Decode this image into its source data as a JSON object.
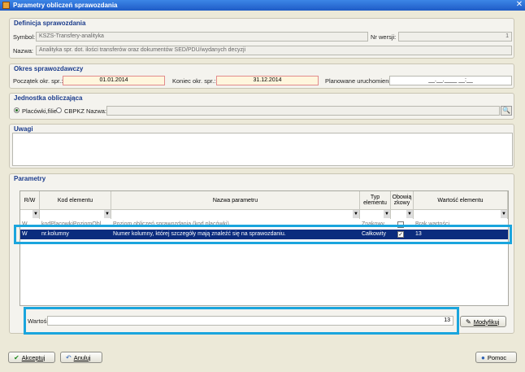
{
  "window": {
    "title": "Parametry obliczeń sprawozdania"
  },
  "definicja": {
    "title": "Definicja sprawozdania",
    "symbol_label": "Symbol:",
    "symbol_value": "KSZS-Transfery-analityka",
    "nr_wersji_label": "Nr wersji:",
    "nr_wersji_value": "1",
    "nazwa_label": "Nazwa:",
    "nazwa_value": "Analityka spr. dot. ilości transferów oraz dokumentów SED/PDU/wydanych decyzji"
  },
  "okres": {
    "title": "Okres sprawozdawczy",
    "poczatek_label": "Początek okr. spr.:",
    "poczatek_value": "01.01.2014",
    "koniec_label": "Koniec okr. spr.:",
    "koniec_value": "31.12.2014",
    "planowane_label": "Planowane uruchomienie:",
    "planowane_value": "__.__.____ __:__"
  },
  "jednostka": {
    "title": "Jednostka obliczająca",
    "radio1_label": "Placówki,filie",
    "radio2_label": "CBPKZ",
    "nazwa_label": "Nazwa:",
    "nazwa_value": ""
  },
  "uwagi": {
    "title": "Uwagi",
    "value": ""
  },
  "parametry": {
    "title": "Parametry",
    "columns": [
      "R/W",
      "Kod elementu",
      "Nazwa parametru",
      "Typ elementu",
      "Obowią zkowy",
      "Wartość elementu"
    ],
    "rows": [
      {
        "rw": "W",
        "kod": "kodPlacowkiPoziomObl",
        "nazwa": "Poziom obliczeń sprawozdania (kod placówki)",
        "typ": "Znakowy",
        "obow": false,
        "wartosc": "Brak wartości"
      },
      {
        "rw": "W",
        "kod": "nr.kolumny",
        "nazwa": "Numer kolumny, której szczegóły mają znaleźć się na sprawozdaniu.",
        "typ": "Całkowity",
        "obow": true,
        "wartosc": "13"
      }
    ],
    "wartosc_label": "Wartość:",
    "wartosc_value": "13",
    "modyfikuj_label": "Modyfikuj"
  },
  "footer": {
    "akceptuj_label": "Akceptuj",
    "anuluj_label": "Anuluj",
    "pomoc_label": "Pomoc"
  }
}
